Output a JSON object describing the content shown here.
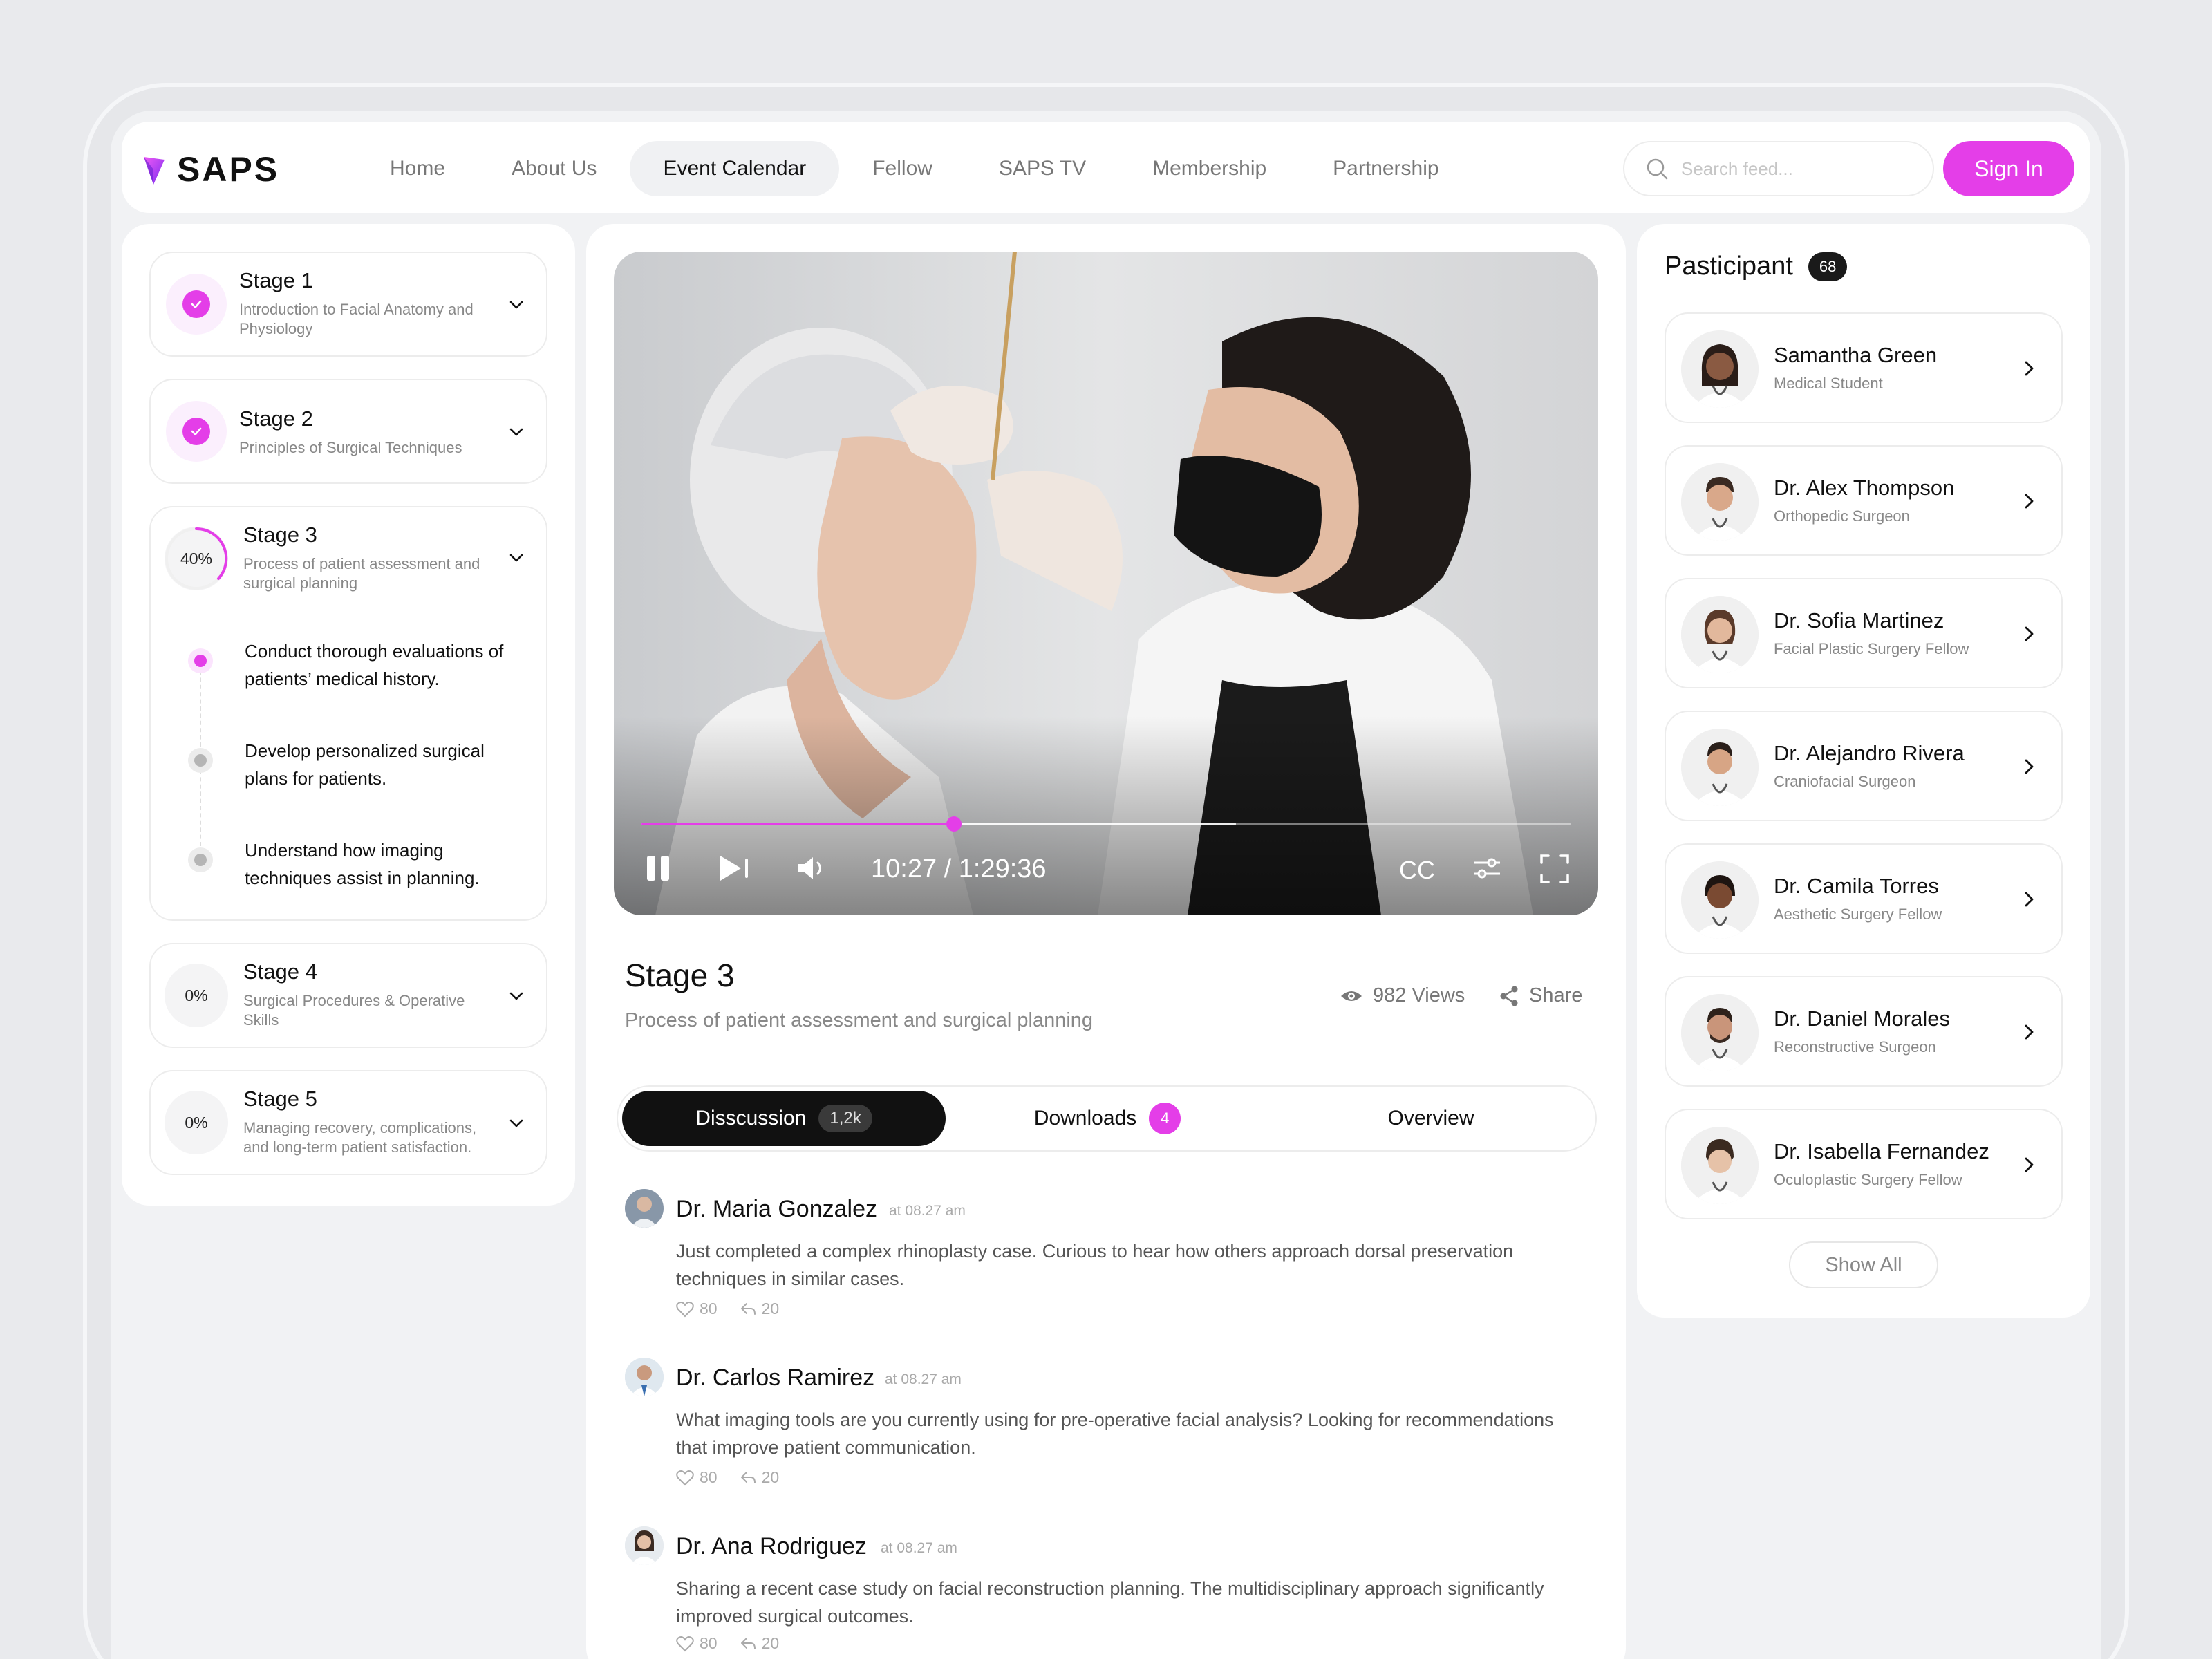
{
  "brand": {
    "name": "SAPS",
    "accent": "#e43ee8"
  },
  "nav": {
    "items": [
      {
        "label": "Home"
      },
      {
        "label": "About Us"
      },
      {
        "label": "Event Calendar",
        "active": true
      },
      {
        "label": "Fellow"
      },
      {
        "label": "SAPS TV"
      },
      {
        "label": "Membership"
      },
      {
        "label": "Partnership"
      }
    ],
    "search_placeholder": "Search feed...",
    "signin_label": "Sign In"
  },
  "stages": [
    {
      "title": "Stage 1",
      "subtitle": "Introduction to Facial Anatomy and Physiology",
      "status": "completed"
    },
    {
      "title": "Stage 2",
      "subtitle": "Principles of Surgical Techniques",
      "status": "completed"
    },
    {
      "title": "Stage 3",
      "subtitle": "Process of patient assessment and surgical planning",
      "status": "in-progress",
      "progress": "40%",
      "steps": [
        {
          "text": "Conduct thorough evaluations of patients’ medical history.",
          "active": true
        },
        {
          "text": "Develop personalized surgical plans for patients.",
          "active": false
        },
        {
          "text": "Understand how imaging techniques assist in planning.",
          "active": false
        }
      ]
    },
    {
      "title": "Stage 4",
      "subtitle": "Surgical Procedures & Operative Skills",
      "status": "not-started",
      "progress": "0%"
    },
    {
      "title": "Stage 5",
      "subtitle": "Managing recovery, complications, and long-term patient satisfaction.",
      "status": "not-started",
      "progress": "0%"
    }
  ],
  "video": {
    "time": "10:27 / 1:29:36",
    "cc_label": "CC",
    "played_fraction": 0.336,
    "buffered_fraction": 0.64,
    "title": "Stage 3",
    "subtitle": "Process of patient assessment and surgical planning",
    "views": "982 Views",
    "share_label": "Share"
  },
  "tabs": {
    "discussion": {
      "label": "Disscussion",
      "count": "1,2k"
    },
    "downloads": {
      "label": "Downloads",
      "count": "4"
    },
    "overview": {
      "label": "Overview"
    }
  },
  "comments": [
    {
      "name": "Dr. Maria Gonzalez",
      "time": "at 08.27 am",
      "text": "Just completed a complex rhinoplasty case. Curious to hear how others approach dorsal preservation techniques in similar cases.",
      "likes": "80",
      "replies": "20"
    },
    {
      "name": "Dr. Carlos Ramirez",
      "time": "at 08.27 am",
      "text": "What imaging tools are you currently using for pre-operative facial analysis? Looking for recommendations that improve patient communication.",
      "likes": "80",
      "replies": "20"
    },
    {
      "name": "Dr. Ana Rodriguez",
      "time": "at 08.27 am",
      "text": "Sharing a recent case study on facial reconstruction planning. The multidisciplinary approach significantly improved surgical outcomes.",
      "likes": "80",
      "replies": "20"
    }
  ],
  "participants": {
    "title": "Pasticipant",
    "count": "68",
    "items": [
      {
        "name": "Samantha Green",
        "role": "Medical Student"
      },
      {
        "name": "Dr. Alex Thompson",
        "role": "Orthopedic Surgeon"
      },
      {
        "name": "Dr. Sofia Martinez",
        "role": "Facial Plastic Surgery Fellow"
      },
      {
        "name": "Dr. Alejandro Rivera",
        "role": "Craniofacial Surgeon"
      },
      {
        "name": "Dr. Camila Torres",
        "role": "Aesthetic Surgery Fellow"
      },
      {
        "name": "Dr. Daniel Morales",
        "role": "Reconstructive Surgeon"
      },
      {
        "name": "Dr. Isabella Fernandez",
        "role": "Oculoplastic Surgery Fellow"
      }
    ],
    "show_all_label": "Show All"
  }
}
